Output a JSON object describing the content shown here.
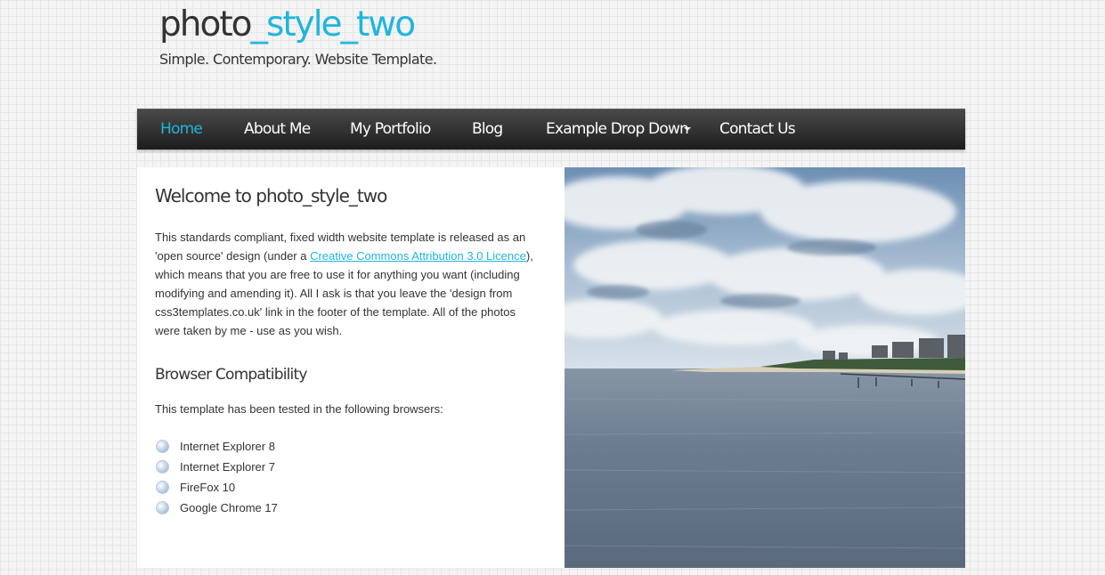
{
  "header": {
    "logo_part1": "photo",
    "logo_part2": "_style_two",
    "slogan": "Simple. Contemporary. Website Template."
  },
  "menu": {
    "items": [
      {
        "label": "Home",
        "selected": true
      },
      {
        "label": "About Me"
      },
      {
        "label": "My Portfolio"
      },
      {
        "label": "Blog"
      },
      {
        "label": "Example Drop Down",
        "has_dropdown": true
      },
      {
        "label": "Contact Us"
      }
    ]
  },
  "content": {
    "heading": "Welcome to photo_style_two",
    "intro_before_link": "This standards compliant, fixed width website template is released as an 'open source' design (under a ",
    "link_text": "Creative Commons Attribution 3.0 Licence",
    "intro_after_link": "), which means that you are free to use it for anything you want (including modifying and amending it). All I ask is that you leave the 'design from css3templates.co.uk' link in the footer of the template. All of the photos were taken by me - use as you wish.",
    "subheading": "Browser Compatibility",
    "tested_text": "This template has been tested in the following browsers:",
    "browsers": [
      "Internet Explorer 8",
      "Internet Explorer 7",
      "FireFox 10",
      "Google Chrome 17"
    ]
  },
  "colors": {
    "accent": "#1fb5dd",
    "menubar": "#2a2a2a",
    "text": "#333333"
  }
}
